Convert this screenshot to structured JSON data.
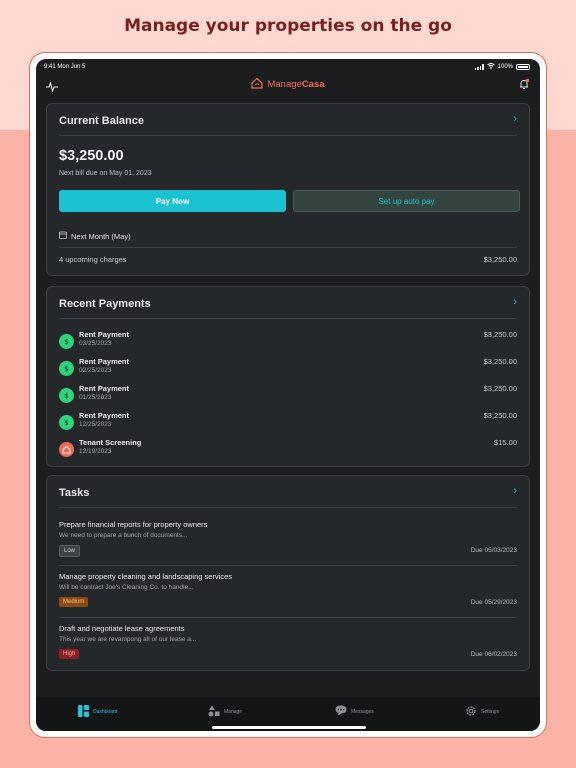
{
  "headline": "Manage your properties on the go",
  "status_bar": {
    "time": "9:41",
    "date": "Mon Jun 5",
    "battery": "100%"
  },
  "app": {
    "brand_part1": "Manage",
    "brand_part2": "Casa"
  },
  "balance_card": {
    "title": "Current Balance",
    "amount": "$3,250.00",
    "due_text": "Next bill due on May 01, 2023",
    "pay_now_label": "Pay Now",
    "auto_pay_label": "Set up auto pay",
    "next_month_label": "Next Month (May)",
    "upcoming_label": "4 upcoming charges",
    "upcoming_amount": "$3,250.00"
  },
  "payments_card": {
    "title": "Recent Payments",
    "items": [
      {
        "name": "Rent Payment",
        "date": "03/25/2023",
        "amount": "$3,250.00",
        "icon": "dollar-icon"
      },
      {
        "name": "Rent Payment",
        "date": "02/25/2023",
        "amount": "$3,250.00",
        "icon": "dollar-icon"
      },
      {
        "name": "Rent Payment",
        "date": "01/25/2023",
        "amount": "$3,250.00",
        "icon": "dollar-icon"
      },
      {
        "name": "Rent Payment",
        "date": "12/25/2023",
        "amount": "$3,250.00",
        "icon": "dollar-icon"
      },
      {
        "name": "Tenant Screening",
        "date": "12/19/2023",
        "amount": "$15.00",
        "icon": "house-icon"
      }
    ]
  },
  "tasks_card": {
    "title": "Tasks",
    "items": [
      {
        "title": "Prepare financial reports for property owners",
        "description": "We need to prepare a bunch of documents...",
        "priority": "Low",
        "due": "Due 05/03/2023"
      },
      {
        "title": "Manage property cleaning and landscaping services",
        "description": "Will be contract Joe's Cleaning Co. to handle...",
        "priority": "Medium",
        "due": "Due 05/29/2023"
      },
      {
        "title": "Draft and negotiate lease agreements",
        "description": "This year we are revampong all of our lease a...",
        "priority": "High",
        "due": "Due 06/02/2023"
      }
    ]
  },
  "tabbar": {
    "dashboard": "Dashboard",
    "manage": "Manage",
    "messages": "Messages",
    "settings": "Settings"
  },
  "colors": {
    "accent": "#1bc2d1",
    "brand": "#ef6a54",
    "payment_icon": "#2ed47a",
    "screening_icon": "#ef6a54"
  }
}
